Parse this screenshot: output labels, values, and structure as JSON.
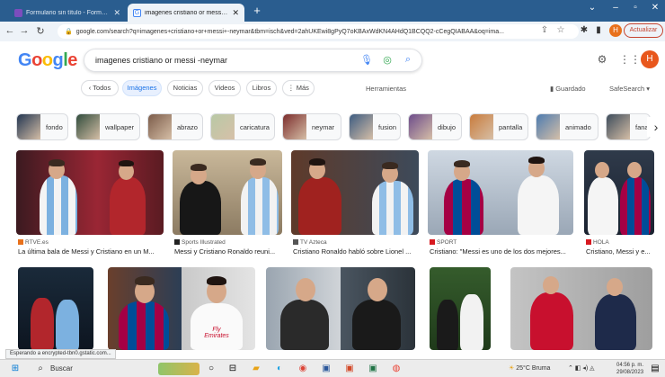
{
  "browser": {
    "tabs": [
      {
        "label": "Formulario sin título - Formulari...",
        "active": false
      },
      {
        "label": "imagenes cristiano or messi -ney...",
        "active": true
      }
    ],
    "new_tab": "+",
    "url": "google.com/search?q=imagenes+cristiano+or+messi+-neymar&tbm=isch&ved=2ahUKEwi8gPyQ7oKBAxWdKN4AHdQ1BCQQ2-cCegQIABAA&oq=ima...",
    "update_label": "Actualizar",
    "profile_initial": "H"
  },
  "google": {
    "logo": "Google",
    "query": "imagenes cristiano or messi -neymar",
    "user_initial": "H",
    "filters": {
      "all": "Todos",
      "images": "Imágenes",
      "news": "Noticias",
      "videos": "Videos",
      "books": "Libros",
      "more": "Más",
      "tools": "Herramientas",
      "saved": "Guardado",
      "safesearch": "SafeSearch"
    },
    "chips": [
      "fondo",
      "wallpaper",
      "abrazo",
      "caricatura",
      "neymar",
      "fusion",
      "dibujo",
      "pantalla",
      "animado",
      "fana"
    ]
  },
  "results": [
    {
      "source": "RTVE.es",
      "title": "La última bala de Messi y Cristiano en un M..."
    },
    {
      "source": "Sports Illustrated",
      "title": "Messi y Cristiano Ronaldo reuni..."
    },
    {
      "source": "TV Azteca",
      "title": "Cristiano Ronaldo habló sobre Lionel ..."
    },
    {
      "source": "SPORT",
      "title": "Cristiano: \"Messi es uno de los dos mejores..."
    },
    {
      "source": "HOLA",
      "title": "Cristiano, Messi y e..."
    }
  ],
  "image_text": {
    "fly": "Fly",
    "emirates": "Emirates"
  },
  "status": "Esperando a encrypted-tbn0.gstatic.com...",
  "taskbar": {
    "search": "Buscar",
    "weather": "25°C  Bruma",
    "time": "04:56 p. m.",
    "date": "29/08/2023"
  },
  "colors": {
    "titlebar": "#2a5d8f",
    "active_filter": "#1a73e8",
    "google_blue": "#4285f4",
    "google_red": "#ea4335",
    "google_yellow": "#fbbc05",
    "google_green": "#34a853"
  }
}
